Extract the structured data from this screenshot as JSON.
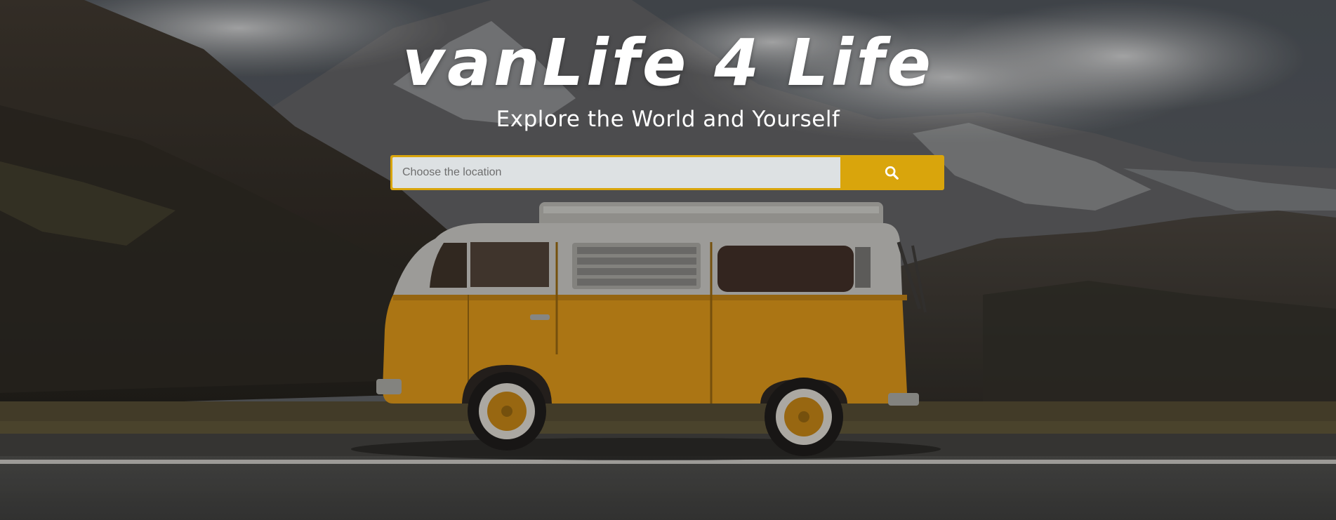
{
  "hero": {
    "title": "vanLife 4 Life",
    "tagline": "Explore the World and Yourself",
    "background": "mountain-road-yellow-van-photo"
  },
  "search": {
    "placeholder": "Choose the location",
    "value": "",
    "button_icon": "search-icon"
  },
  "colors": {
    "accent": "#d9a50c",
    "input_bg": "#dde1e3",
    "title_text": "#ffffff",
    "van_body": "#d99a1e"
  }
}
